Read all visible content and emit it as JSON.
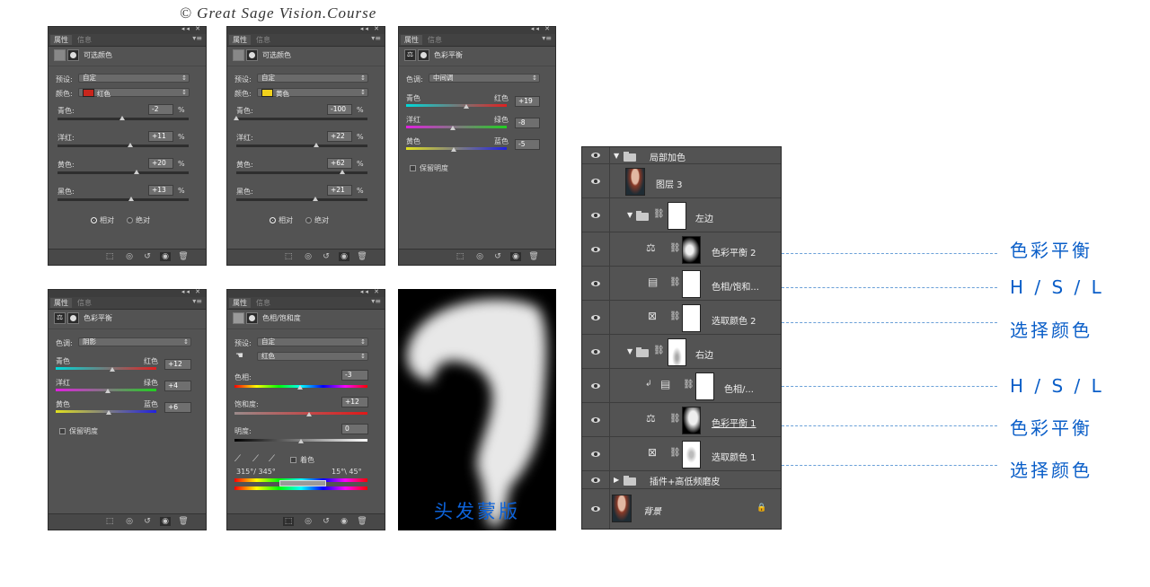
{
  "credit": "© Great Sage Vision.Course",
  "tabs": {
    "properties": "属性",
    "info": "信息"
  },
  "footer_icons": [
    "clip-to-layer-icon",
    "view-previous-icon",
    "reset-icon",
    "visibility-icon",
    "delete-icon"
  ],
  "panels": {
    "p1": {
      "title": "可选颜色",
      "preset_label": "预设:",
      "preset_value": "自定",
      "colors_label": "颜色:",
      "colors_value": "红色",
      "colors_swatch": "#c8261c",
      "sliders": [
        {
          "label": "青色:",
          "value": "-2",
          "unit": "%",
          "level": 0.49
        },
        {
          "label": "洋红:",
          "value": "+11",
          "unit": "%",
          "level": 0.555
        },
        {
          "label": "黄色:",
          "value": "+20",
          "unit": "%",
          "level": 0.6
        },
        {
          "label": "黑色:",
          "value": "+13",
          "unit": "%",
          "level": 0.565
        }
      ],
      "radio_relative": "相对",
      "radio_absolute": "绝对"
    },
    "p2": {
      "title": "可选颜色",
      "preset_label": "预设:",
      "preset_value": "自定",
      "colors_label": "颜色:",
      "colors_value": "黄色",
      "colors_swatch": "#f2d21c",
      "sliders": [
        {
          "label": "青色:",
          "value": "-100",
          "unit": "%",
          "level": 0.0
        },
        {
          "label": "洋红:",
          "value": "+22",
          "unit": "%",
          "level": 0.61
        },
        {
          "label": "黄色:",
          "value": "+62",
          "unit": "%",
          "level": 0.81
        },
        {
          "label": "黑色:",
          "value": "+21",
          "unit": "%",
          "level": 0.605
        }
      ],
      "radio_relative": "相对",
      "radio_absolute": "绝对"
    },
    "p3": {
      "title": "色彩平衡",
      "tone_label": "色调:",
      "tone_value": "中间调",
      "sliders": [
        {
          "left": "青色",
          "right": "红色",
          "value": "+19",
          "level": 0.595
        },
        {
          "left": "洋红",
          "right": "绿色",
          "value": "-8",
          "level": 0.46
        },
        {
          "left": "黄色",
          "right": "蓝色",
          "value": "-5",
          "level": 0.475
        }
      ],
      "preserve": "保留明度"
    },
    "p4": {
      "title": "色彩平衡",
      "tone_label": "色调:",
      "tone_value": "阴影",
      "sliders": [
        {
          "left": "青色",
          "right": "红色",
          "value": "+12",
          "level": 0.56
        },
        {
          "left": "洋红",
          "right": "绿色",
          "value": "+4",
          "level": 0.52
        },
        {
          "left": "黄色",
          "right": "蓝色",
          "value": "+6",
          "level": 0.53
        }
      ],
      "preserve": "保留明度"
    },
    "p5": {
      "title": "色相/饱和度",
      "preset_label": "预设:",
      "preset_value": "自定",
      "channel_value": "红色",
      "hue_label": "色相:",
      "hue_value": "-3",
      "hue_level": 0.49,
      "sat_label": "饱和度:",
      "sat_value": "+12",
      "sat_level": 0.56,
      "light_label": "明度:",
      "light_value": "0",
      "light_level": 0.5,
      "colorize": "着色",
      "range_left": "315°/ 345°",
      "range_right": "15°\\ 45°"
    }
  },
  "mask": {
    "label": "头发蒙版"
  },
  "layers": [
    {
      "name": "局部加色",
      "kind": "group",
      "expanded": true
    },
    {
      "name": "图层 3",
      "kind": "photo"
    },
    {
      "name": "左边",
      "kind": "group",
      "expanded": true
    },
    {
      "name": "色彩平衡 2",
      "kind": "adjust",
      "icon": "balance-icon"
    },
    {
      "name": "色相/饱和...",
      "kind": "adjust",
      "icon": "hue-saturation-icon"
    },
    {
      "name": "选取颜色 2",
      "kind": "adjust",
      "icon": "selective-color-icon"
    },
    {
      "name": "右边",
      "kind": "group",
      "expanded": true
    },
    {
      "name": "色相/...",
      "kind": "adjust",
      "icon": "hue-saturation-icon"
    },
    {
      "name": "色彩平衡 1",
      "kind": "adjust",
      "icon": "balance-icon"
    },
    {
      "name": "选取颜色 1",
      "kind": "adjust",
      "icon": "selective-color-icon"
    },
    {
      "name": "插件+高低频磨皮",
      "kind": "group",
      "expanded": false
    },
    {
      "name": "背景",
      "kind": "background"
    }
  ],
  "callouts": [
    "色彩平衡",
    "H / S / L",
    "选择颜色",
    "H / S / L",
    "色彩平衡",
    "选择颜色"
  ],
  "colors": {
    "accent": "#0a5ec8",
    "panel_bg": "#535353"
  }
}
